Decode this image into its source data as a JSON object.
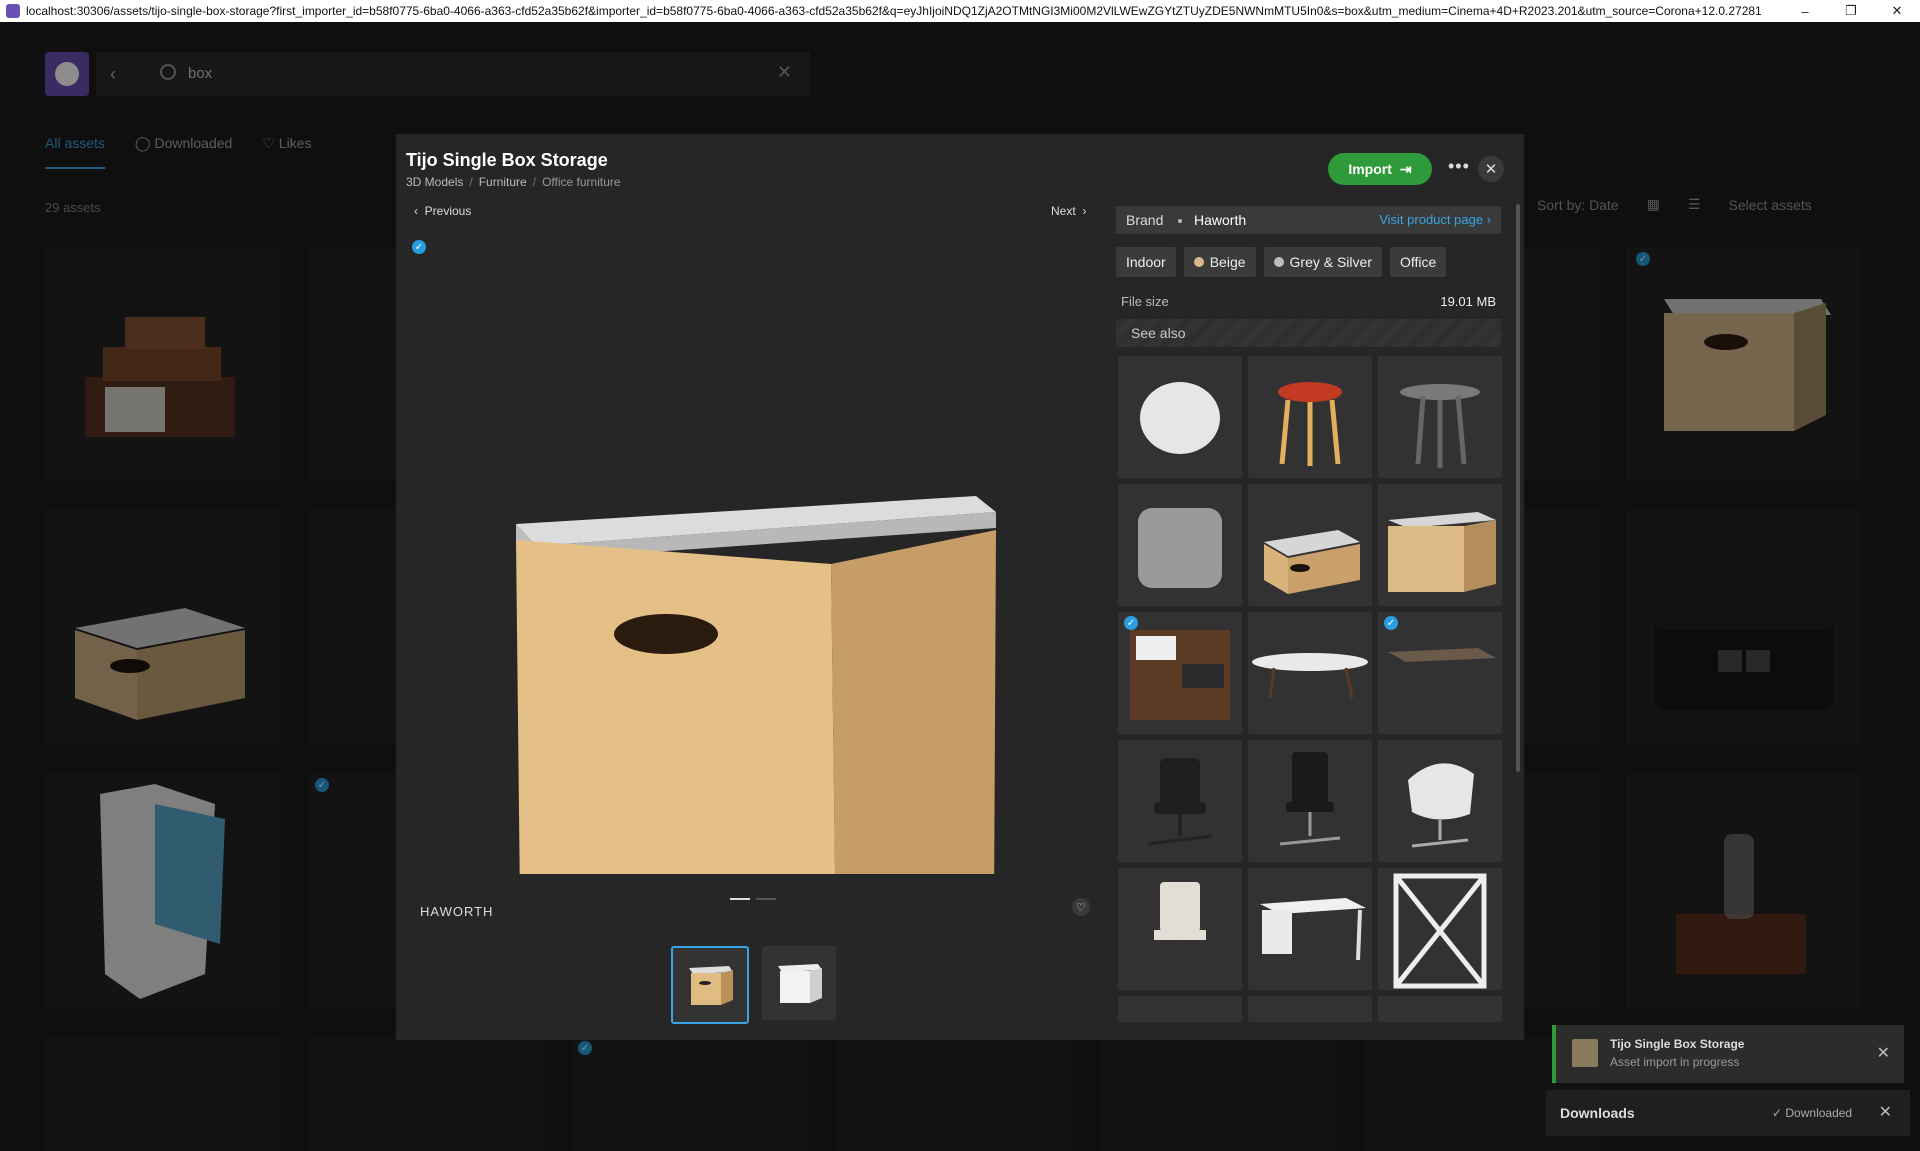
{
  "window": {
    "url": "localhost:30306/assets/tijo-single-box-storage?first_importer_id=b58f0775-6ba0-4066-a363-cfd52a35b62f&importer_id=b58f0775-6ba0-4066-a363-cfd52a35b62f&q=eyJhIjoiNDQ1ZjA2OTMtNGI3Mi00M2VlLWEwZGYtZTUyZDE5NWNmMTU5In0&s=box&utm_medium=Cinema+4D+R2023.201&utm_source=Corona+12.0.27281",
    "minimize": "–",
    "maximize": "❐",
    "close": "✕"
  },
  "search": {
    "value": "box",
    "back": "‹",
    "clear": "✕"
  },
  "tabs": [
    {
      "label": "All assets"
    },
    {
      "label": "Downloaded"
    },
    {
      "label": "Likes"
    }
  ],
  "asset_count": "29 assets",
  "sort": {
    "label": "Sort by: Date",
    "select": "Select assets"
  },
  "modal": {
    "title": "Tijo Single Box Storage",
    "breadcrumb": [
      "3D Models",
      "Furniture",
      "Office furniture"
    ],
    "import_label": "Import",
    "more": "•••",
    "close": "✕",
    "previous": "Previous",
    "next": "Next",
    "brand_mark": "HAWORTH",
    "like": "♡",
    "brand_label": "Brand",
    "brand_value": "Haworth",
    "product_link": "Visit product page ›",
    "tags": [
      {
        "label": "Indoor",
        "swatch": ""
      },
      {
        "label": "Beige",
        "swatch": "#d9b98a"
      },
      {
        "label": "Grey & Silver",
        "swatch": "#bdbdbd"
      },
      {
        "label": "Office",
        "swatch": ""
      }
    ],
    "file_size_label": "File size",
    "file_size_value": "19.01 MB",
    "see_also": "See also",
    "see_also_items": [
      "vase",
      "stool",
      "side-table",
      "pouf",
      "box-storage",
      "box-storage",
      "bookshelf",
      "coffee-table",
      "desk",
      "office-chair",
      "office-chair",
      "lounge-chair",
      "office-chair",
      "desk",
      "shelf"
    ]
  },
  "toast": {
    "title": "Tijo Single Box Storage",
    "status": "Asset import in progress",
    "close": "✕"
  },
  "downloads": {
    "title": "Downloads",
    "status": "✓ Downloaded",
    "close": "✕"
  },
  "colors": {
    "accent": "#3aa3e3",
    "import": "#2e9a3a",
    "brand": "#6a4fb5"
  }
}
